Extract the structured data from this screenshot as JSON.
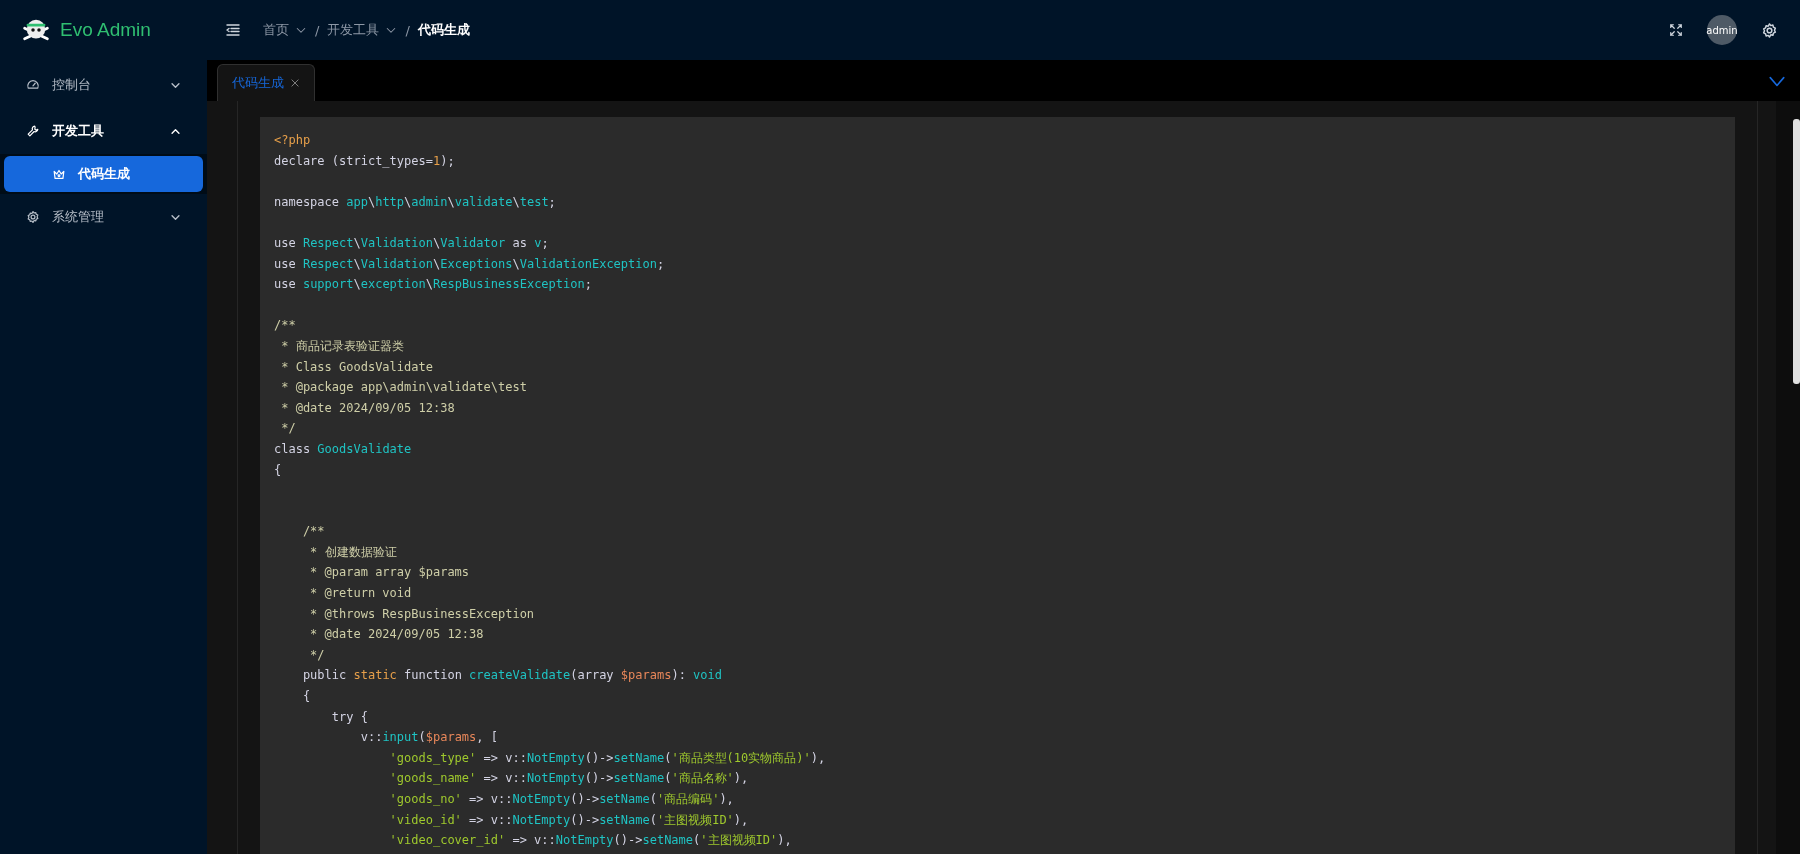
{
  "app": {
    "title": "Evo Admin"
  },
  "sidebar": {
    "items": [
      {
        "label": "控制台",
        "expanded": false
      },
      {
        "label": "开发工具",
        "expanded": true,
        "children": [
          {
            "label": "代码生成",
            "selected": true
          }
        ]
      },
      {
        "label": "系统管理",
        "expanded": false
      }
    ]
  },
  "breadcrumb": [
    {
      "label": "首页",
      "dropdown": true,
      "current": false
    },
    {
      "separator": "/",
      "label": "开发工具",
      "dropdown": true,
      "current": false
    },
    {
      "separator": "/",
      "label": "代码生成",
      "dropdown": false,
      "current": true
    }
  ],
  "user": {
    "avatar_text": "admin"
  },
  "tabs": [
    {
      "label": "代码生成",
      "selected": true,
      "closable": true
    }
  ],
  "code": {
    "lines": [
      {
        "kind": "code",
        "tokens": [
          {
            "kind": "keyword",
            "text": "<?php"
          }
        ]
      },
      {
        "kind": "code",
        "tokens": [
          {
            "kind": "plain",
            "text": "declare (strict_types="
          },
          {
            "kind": "keyword",
            "text": "1"
          },
          {
            "kind": "plain",
            "text": ");"
          }
        ]
      },
      {
        "kind": "blank"
      },
      {
        "kind": "code",
        "tokens": [
          {
            "kind": "plain",
            "text": "namespace "
          },
          {
            "kind": "name",
            "text": "app"
          },
          {
            "kind": "plain",
            "text": "\\"
          },
          {
            "kind": "name",
            "text": "http"
          },
          {
            "kind": "plain",
            "text": "\\"
          },
          {
            "kind": "name",
            "text": "admin"
          },
          {
            "kind": "plain",
            "text": "\\"
          },
          {
            "kind": "name",
            "text": "validate"
          },
          {
            "kind": "plain",
            "text": "\\"
          },
          {
            "kind": "name",
            "text": "test"
          },
          {
            "kind": "plain",
            "text": ";"
          }
        ]
      },
      {
        "kind": "blank"
      },
      {
        "kind": "code",
        "tokens": [
          {
            "kind": "plain",
            "text": "use "
          },
          {
            "kind": "name",
            "text": "Respect"
          },
          {
            "kind": "plain",
            "text": "\\"
          },
          {
            "kind": "name",
            "text": "Validation"
          },
          {
            "kind": "plain",
            "text": "\\"
          },
          {
            "kind": "name",
            "text": "Validator"
          },
          {
            "kind": "plain",
            "text": " as "
          },
          {
            "kind": "name",
            "text": "v"
          },
          {
            "kind": "plain",
            "text": ";"
          }
        ]
      },
      {
        "kind": "code",
        "tokens": [
          {
            "kind": "plain",
            "text": "use "
          },
          {
            "kind": "name",
            "text": "Respect"
          },
          {
            "kind": "plain",
            "text": "\\"
          },
          {
            "kind": "name",
            "text": "Validation"
          },
          {
            "kind": "plain",
            "text": "\\"
          },
          {
            "kind": "name",
            "text": "Exceptions"
          },
          {
            "kind": "plain",
            "text": "\\"
          },
          {
            "kind": "name",
            "text": "ValidationException"
          },
          {
            "kind": "plain",
            "text": ";"
          }
        ]
      },
      {
        "kind": "code",
        "tokens": [
          {
            "kind": "plain",
            "text": "use "
          },
          {
            "kind": "name",
            "text": "support"
          },
          {
            "kind": "plain",
            "text": "\\"
          },
          {
            "kind": "name",
            "text": "exception"
          },
          {
            "kind": "plain",
            "text": "\\"
          },
          {
            "kind": "name",
            "text": "RespBusinessException"
          },
          {
            "kind": "plain",
            "text": ";"
          }
        ]
      },
      {
        "kind": "blank"
      },
      {
        "kind": "code",
        "tokens": [
          {
            "kind": "comment",
            "text": "/**"
          }
        ]
      },
      {
        "kind": "code",
        "tokens": [
          {
            "kind": "comment",
            "text": " * 商品记录表验证器类"
          }
        ]
      },
      {
        "kind": "code",
        "tokens": [
          {
            "kind": "comment",
            "text": " * Class GoodsValidate"
          }
        ]
      },
      {
        "kind": "code",
        "tokens": [
          {
            "kind": "comment",
            "text": " * @package app\\admin\\validate\\test"
          }
        ]
      },
      {
        "kind": "code",
        "tokens": [
          {
            "kind": "comment",
            "text": " * @date 2024/09/05 12:38"
          }
        ]
      },
      {
        "kind": "code",
        "tokens": [
          {
            "kind": "comment",
            "text": " */"
          }
        ]
      },
      {
        "kind": "code",
        "tokens": [
          {
            "kind": "plain",
            "text": "class "
          },
          {
            "kind": "name",
            "text": "GoodsValidate"
          }
        ]
      },
      {
        "kind": "code",
        "tokens": [
          {
            "kind": "plain",
            "text": "{"
          }
        ]
      },
      {
        "kind": "blank"
      },
      {
        "kind": "blank"
      },
      {
        "kind": "code",
        "tokens": [
          {
            "kind": "comment",
            "text": "    /**"
          }
        ]
      },
      {
        "kind": "code",
        "tokens": [
          {
            "kind": "comment",
            "text": "     * 创建数据验证"
          }
        ]
      },
      {
        "kind": "code",
        "tokens": [
          {
            "kind": "comment",
            "text": "     * @param array $params"
          }
        ]
      },
      {
        "kind": "code",
        "tokens": [
          {
            "kind": "comment",
            "text": "     * @return void"
          }
        ]
      },
      {
        "kind": "code",
        "tokens": [
          {
            "kind": "comment",
            "text": "     * @throws RespBusinessException"
          }
        ]
      },
      {
        "kind": "code",
        "tokens": [
          {
            "kind": "comment",
            "text": "     * @date 2024/09/05 12:38"
          }
        ]
      },
      {
        "kind": "code",
        "tokens": [
          {
            "kind": "comment",
            "text": "     */"
          }
        ]
      },
      {
        "kind": "code",
        "tokens": [
          {
            "kind": "plain",
            "text": "    public "
          },
          {
            "kind": "keyword",
            "text": "static"
          },
          {
            "kind": "plain",
            "text": " function "
          },
          {
            "kind": "name",
            "text": "createValidate"
          },
          {
            "kind": "plain",
            "text": "(array "
          },
          {
            "kind": "variable",
            "text": "$params"
          },
          {
            "kind": "plain",
            "text": "): "
          },
          {
            "kind": "name",
            "text": "void"
          }
        ]
      },
      {
        "kind": "code",
        "tokens": [
          {
            "kind": "plain",
            "text": "    {"
          }
        ]
      },
      {
        "kind": "code",
        "tokens": [
          {
            "kind": "plain",
            "text": "        try {"
          }
        ]
      },
      {
        "kind": "code",
        "tokens": [
          {
            "kind": "plain",
            "text": "            v::"
          },
          {
            "kind": "name",
            "text": "input"
          },
          {
            "kind": "plain",
            "text": "("
          },
          {
            "kind": "variable",
            "text": "$params"
          },
          {
            "kind": "plain",
            "text": ", ["
          }
        ]
      },
      {
        "kind": "code",
        "tokens": [
          {
            "kind": "string",
            "text": "                'goods_type'"
          },
          {
            "kind": "plain",
            "text": " => v::"
          },
          {
            "kind": "name",
            "text": "NotEmpty"
          },
          {
            "kind": "plain",
            "text": "()->"
          },
          {
            "kind": "name",
            "text": "setName"
          },
          {
            "kind": "plain",
            "text": "("
          },
          {
            "kind": "string",
            "text": "'商品类型(10实物商品)'"
          },
          {
            "kind": "plain",
            "text": "),"
          }
        ]
      },
      {
        "kind": "code",
        "tokens": [
          {
            "kind": "string",
            "text": "                'goods_name'"
          },
          {
            "kind": "plain",
            "text": " => v::"
          },
          {
            "kind": "name",
            "text": "NotEmpty"
          },
          {
            "kind": "plain",
            "text": "()->"
          },
          {
            "kind": "name",
            "text": "setName"
          },
          {
            "kind": "plain",
            "text": "("
          },
          {
            "kind": "string",
            "text": "'商品名称'"
          },
          {
            "kind": "plain",
            "text": "),"
          }
        ]
      },
      {
        "kind": "code",
        "tokens": [
          {
            "kind": "string",
            "text": "                'goods_no'"
          },
          {
            "kind": "plain",
            "text": " => v::"
          },
          {
            "kind": "name",
            "text": "NotEmpty"
          },
          {
            "kind": "plain",
            "text": "()->"
          },
          {
            "kind": "name",
            "text": "setName"
          },
          {
            "kind": "plain",
            "text": "("
          },
          {
            "kind": "string",
            "text": "'商品编码'"
          },
          {
            "kind": "plain",
            "text": "),"
          }
        ]
      },
      {
        "kind": "code",
        "tokens": [
          {
            "kind": "string",
            "text": "                'video_id'"
          },
          {
            "kind": "plain",
            "text": " => v::"
          },
          {
            "kind": "name",
            "text": "NotEmpty"
          },
          {
            "kind": "plain",
            "text": "()->"
          },
          {
            "kind": "name",
            "text": "setName"
          },
          {
            "kind": "plain",
            "text": "("
          },
          {
            "kind": "string",
            "text": "'主图视频ID'"
          },
          {
            "kind": "plain",
            "text": "),"
          }
        ]
      },
      {
        "kind": "code",
        "tokens": [
          {
            "kind": "string",
            "text": "                'video_cover_id'"
          },
          {
            "kind": "plain",
            "text": " => v::"
          },
          {
            "kind": "name",
            "text": "NotEmpty"
          },
          {
            "kind": "plain",
            "text": "()->"
          },
          {
            "kind": "name",
            "text": "setName"
          },
          {
            "kind": "plain",
            "text": "("
          },
          {
            "kind": "string",
            "text": "'主图视频ID'"
          },
          {
            "kind": "plain",
            "text": "),"
          }
        ]
      }
    ]
  }
}
